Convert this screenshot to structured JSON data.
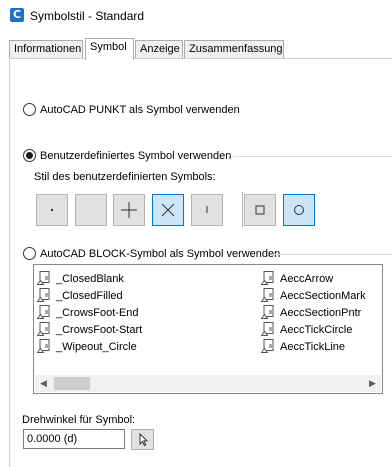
{
  "window": {
    "title": "Symbolstil - Standard",
    "icon": "autocad-c-icon",
    "icon_letter": "C"
  },
  "tabs": [
    {
      "label": "Informationen",
      "active": false
    },
    {
      "label": "Symbol",
      "active": true
    },
    {
      "label": "Anzeige",
      "active": false
    },
    {
      "label": "Zusammenfassung",
      "active": false
    }
  ],
  "options": {
    "point": {
      "label": "AutoCAD PUNKT als Symbol verwenden",
      "checked": false
    },
    "custom": {
      "label": "Benutzerdefiniertes Symbol verwenden",
      "checked": true
    },
    "block": {
      "label": "AutoCAD BLOCK-Symbol als Symbol verwenden",
      "checked": false
    }
  },
  "custom_symbol": {
    "label": "Stil des benutzerdefinierten Symbols:",
    "buttons": [
      {
        "icon": "dot-icon",
        "selected": false
      },
      {
        "icon": "blank-icon",
        "selected": false
      },
      {
        "icon": "plus-icon",
        "selected": true
      },
      {
        "icon": "x-cross-icon",
        "selected": true
      },
      {
        "icon": "tick-icon",
        "selected": false
      },
      {
        "icon": "square-icon",
        "selected": false
      },
      {
        "icon": "circle-icon",
        "selected": true
      }
    ]
  },
  "block_list": {
    "column1": [
      "_ClosedBlank",
      "_ClosedFilled",
      "_CrowsFoot-End",
      "_CrowsFoot-Start",
      "_Wipeout_Circle"
    ],
    "column2": [
      "AeccArrow",
      "AeccSectionMark",
      "AeccSectionPntr",
      "AeccTickCircle",
      "AeccTickLine"
    ],
    "item_icon": "block-icon"
  },
  "scrollbar": {
    "left_arrow": "◀",
    "right_arrow": "▶"
  },
  "rotation": {
    "label": "Drehwinkel für Symbol:",
    "value": "0.0000 (d)"
  },
  "colors": {
    "accent": "#0078d7",
    "selected_fill": "#cce4f7"
  }
}
